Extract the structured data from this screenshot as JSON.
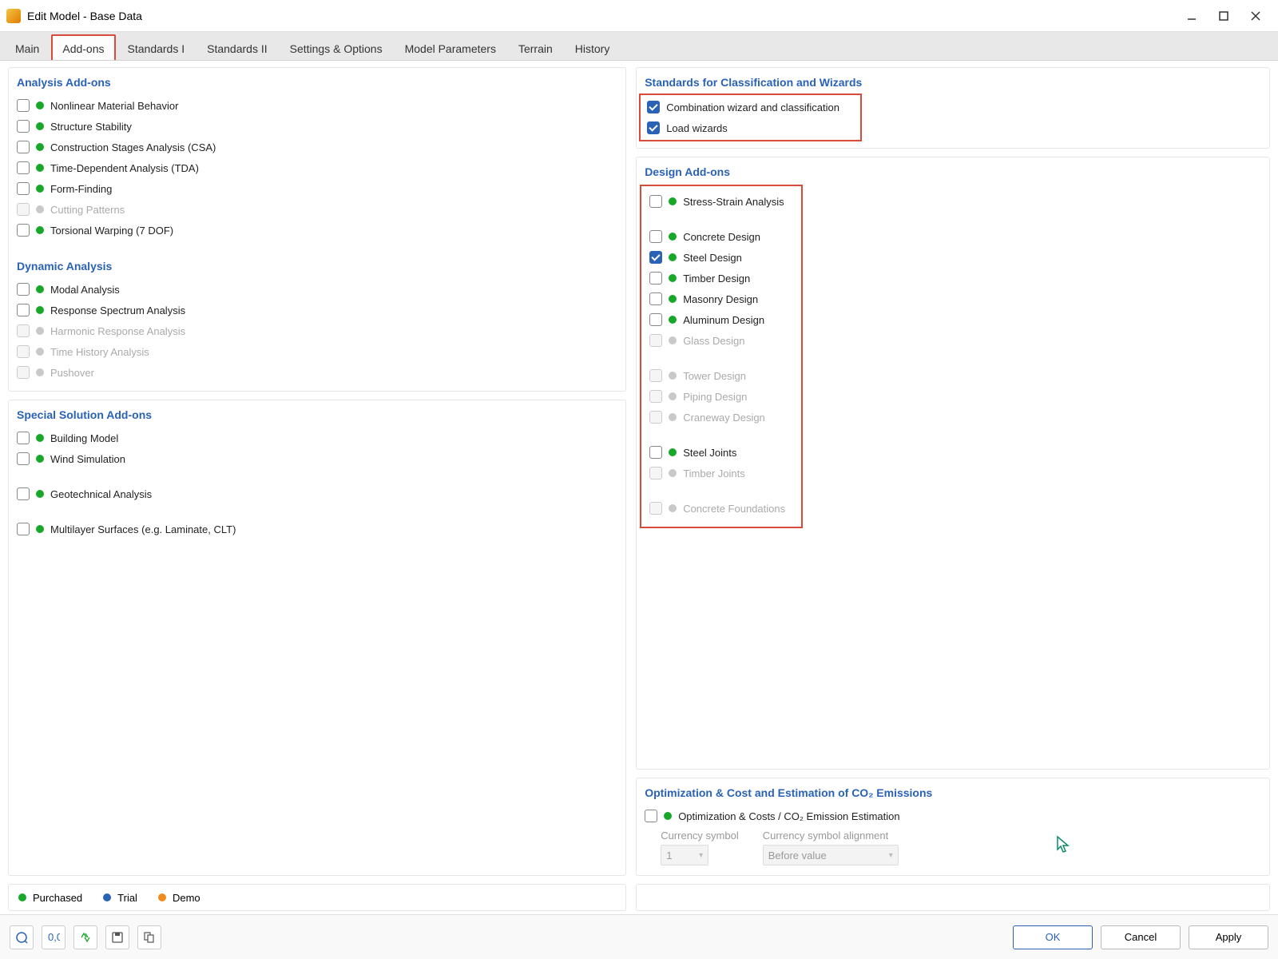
{
  "window": {
    "title": "Edit Model - Base Data"
  },
  "tabs": {
    "main": "Main",
    "addons": "Add-ons",
    "std1": "Standards I",
    "std2": "Standards II",
    "settings": "Settings & Options",
    "params": "Model Parameters",
    "terrain": "Terrain",
    "history": "History"
  },
  "sections": {
    "analysis": "Analysis Add-ons",
    "dynamic": "Dynamic Analysis",
    "special": "Special Solution Add-ons",
    "standards": "Standards for Classification and Wizards",
    "design": "Design Add-ons",
    "optimization": "Optimization & Cost and Estimation of CO₂ Emissions"
  },
  "analysis": {
    "nonlinear": "Nonlinear Material Behavior",
    "stability": "Structure Stability",
    "csa": "Construction Stages Analysis (CSA)",
    "tda": "Time-Dependent Analysis (TDA)",
    "formfinding": "Form-Finding",
    "cutting": "Cutting Patterns",
    "torsional": "Torsional Warping (7 DOF)"
  },
  "dynamic": {
    "modal": "Modal Analysis",
    "response": "Response Spectrum Analysis",
    "harmonic": "Harmonic Response Analysis",
    "timehistory": "Time History Analysis",
    "pushover": "Pushover"
  },
  "special": {
    "building": "Building Model",
    "wind": "Wind Simulation",
    "geo": "Geotechnical Analysis",
    "multilayer": "Multilayer Surfaces (e.g. Laminate, CLT)"
  },
  "standardsItems": {
    "combo": "Combination wizard and classification",
    "load": "Load wizards"
  },
  "design": {
    "stress": "Stress-Strain Analysis",
    "concrete": "Concrete Design",
    "steel": "Steel Design",
    "timber": "Timber Design",
    "masonry": "Masonry Design",
    "aluminum": "Aluminum Design",
    "glass": "Glass Design",
    "tower": "Tower Design",
    "piping": "Piping Design",
    "craneway": "Craneway Design",
    "steeljoints": "Steel Joints",
    "timberjoints": "Timber Joints",
    "foundations": "Concrete Foundations"
  },
  "optimization": {
    "item": "Optimization & Costs / CO₂ Emission Estimation",
    "currency_label": "Currency symbol",
    "currency_value": "1",
    "alignment_label": "Currency symbol alignment",
    "alignment_value": "Before value"
  },
  "legend": {
    "purchased": "Purchased",
    "trial": "Trial",
    "demo": "Demo"
  },
  "buttons": {
    "ok": "OK",
    "cancel": "Cancel",
    "apply": "Apply"
  }
}
